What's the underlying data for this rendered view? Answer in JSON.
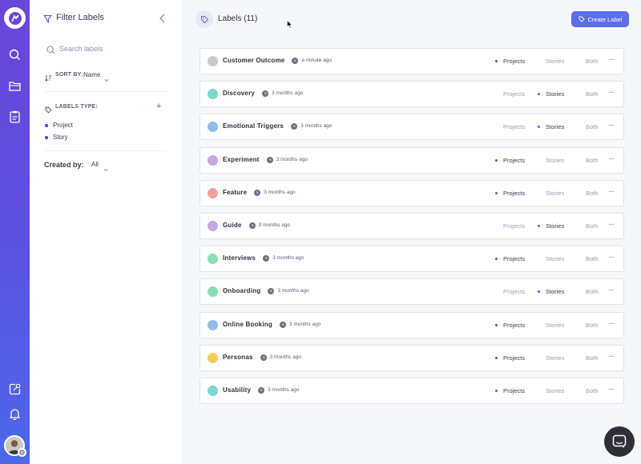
{
  "colors": {
    "accent": "#4b5ce0",
    "rail_top": "#6a45d9",
    "rail_bottom": "#4d68ea",
    "button": "#5a6ee8"
  },
  "rail": {
    "icons": [
      "search-icon",
      "folder-icon",
      "notes-icon",
      "share-icon",
      "bell-icon"
    ]
  },
  "panel": {
    "title": "Filter Labels",
    "search_placeholder": "Search labels",
    "sort_label": "SORT BY:",
    "sort_value": "Name",
    "types_label": "LABELS TYPE:",
    "types_add": "+",
    "types": [
      "Project",
      "Story"
    ],
    "created_label": "Created by:",
    "created_value": "All"
  },
  "header": {
    "title": "Labels (11)",
    "create_label": "Create Label"
  },
  "options": [
    "Projects",
    "Stories",
    "Both"
  ],
  "more_label": "···",
  "labels": [
    {
      "name": "Customer Outcome",
      "time": "a minute ago",
      "color": "#c9c9cf",
      "selected": "Projects"
    },
    {
      "name": "Discovery",
      "time": "3 months ago",
      "color": "#7dd6d1",
      "selected": "Stories"
    },
    {
      "name": "Emotional Triggers",
      "time": "3 months ago",
      "color": "#8fbde8",
      "selected": "Stories"
    },
    {
      "name": "Experiment",
      "time": "3 months ago",
      "color": "#c9a6dd",
      "selected": "Projects"
    },
    {
      "name": "Feature",
      "time": "3 months ago",
      "color": "#f2a29e",
      "selected": "Projects"
    },
    {
      "name": "Guide",
      "time": "3 months ago",
      "color": "#c9a6dd",
      "selected": "Stories"
    },
    {
      "name": "Interviews",
      "time": "3 months ago",
      "color": "#88e0b1",
      "selected": "Projects"
    },
    {
      "name": "Onboarding",
      "time": "3 months ago",
      "color": "#88e0b1",
      "selected": "Stories"
    },
    {
      "name": "Online Booking",
      "time": "3 months ago",
      "color": "#8fbde8",
      "selected": "Projects"
    },
    {
      "name": "Personas",
      "time": "3 months ago",
      "color": "#f5cb5c",
      "selected": "Projects"
    },
    {
      "name": "Usability",
      "time": "3 months ago",
      "color": "#7dd6d1",
      "selected": "Projects"
    }
  ]
}
